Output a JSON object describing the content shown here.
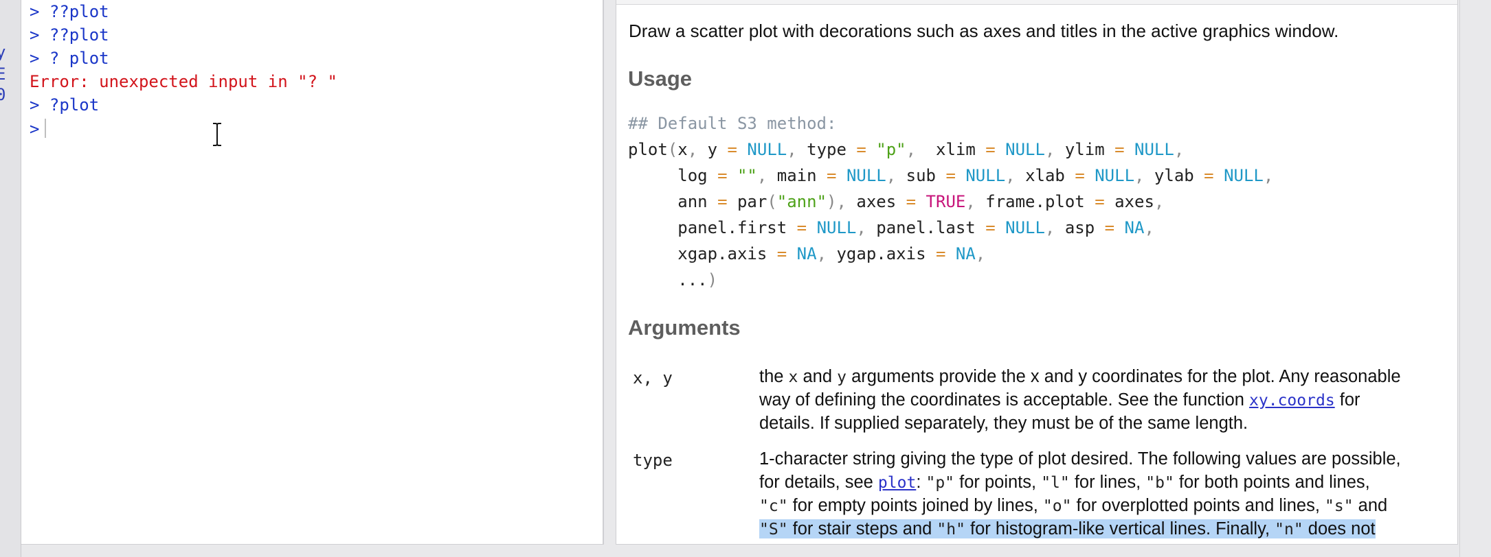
{
  "left_edge": {
    "glyph_1": "y",
    "glyph_2": "E",
    "glyph_3": "0"
  },
  "console": {
    "lines": [
      {
        "prompt": ">",
        "text": "??plot"
      },
      {
        "prompt": ">",
        "text": "??plot"
      },
      {
        "prompt": ">",
        "text": "? plot"
      },
      {
        "error": "Error: unexpected input in \"? \""
      },
      {
        "prompt": ">",
        "text": "?plot"
      },
      {
        "prompt": ">",
        "text": ""
      }
    ]
  },
  "help": {
    "description": "Draw a scatter plot with decorations such as axes and titles in the active graphics window.",
    "usage_heading": "Usage",
    "code_comment": "## Default S3 method:",
    "code": {
      "l1": {
        "fn": "plot",
        "x": "x",
        "y": "y",
        "null": "NULL",
        "type": "type",
        "type_val": "\"p\"",
        "xlim": "xlim",
        "ylim": "ylim"
      },
      "l2": {
        "log": "log",
        "log_val": "\"\"",
        "main": "main",
        "sub": "sub",
        "xlab": "xlab",
        "ylab": "ylab"
      },
      "l3": {
        "ann": "ann",
        "par": "par",
        "ann_str": "\"ann\"",
        "axes": "axes",
        "true": "TRUE",
        "frame": "frame.plot",
        "axes2": "axes"
      },
      "l4": {
        "pf": "panel.first",
        "pl": "panel.last",
        "asp": "asp",
        "na": "NA"
      },
      "l5": {
        "xgap": "xgap.axis",
        "ygap": "ygap.axis",
        "na": "NA"
      },
      "l6": {
        "dots": "..."
      }
    },
    "arguments_heading": "Arguments",
    "args": {
      "xy": {
        "name": "x, y",
        "l1_a": "the ",
        "l1_x": "x",
        "l1_b": " and ",
        "l1_y": "y",
        "l1_c": " arguments provide the x and y coordinates for the plot. Any reasonable",
        "l2_a": "way of defining the coordinates is acceptable. See the function ",
        "l2_link": "xy.coords",
        "l2_b": " for",
        "l3": "details. If supplied separately, they must be of the same length."
      },
      "type": {
        "name": "type",
        "l1": "1-character string giving the type of plot desired. The following values are possible,",
        "l2_a": "for details, see ",
        "l2_link": "plot",
        "l2_b": ": ",
        "l2_p": "\"p\"",
        "l2_c": " for points, ",
        "l2_l": "\"l\"",
        "l2_d": " for lines, ",
        "l2_bv": "\"b\"",
        "l2_e": " for both points and lines,",
        "l3_c": "\"c\"",
        "l3_a": " for empty points joined by lines, ",
        "l3_o": "\"o\"",
        "l3_b": " for overplotted points and lines, ",
        "l3_s": "\"s\"",
        "l3_d": " and",
        "l4_S": "\"S\"",
        "l4_a": " for stair steps and ",
        "l4_h": "\"h\"",
        "l4_b": " for histogram-like vertical lines. Finally, ",
        "l4_n": "\"n\"",
        "l4_c": " does not"
      }
    }
  },
  "colors": {
    "prompt": "#1a36c8",
    "error": "#d2141b",
    "keyword": "#1f98c7",
    "string": "#4ea219",
    "bool": "#c7147a",
    "operator": "#d98b2c",
    "selection": "#b5d5f6",
    "link": "#2a32c8"
  }
}
